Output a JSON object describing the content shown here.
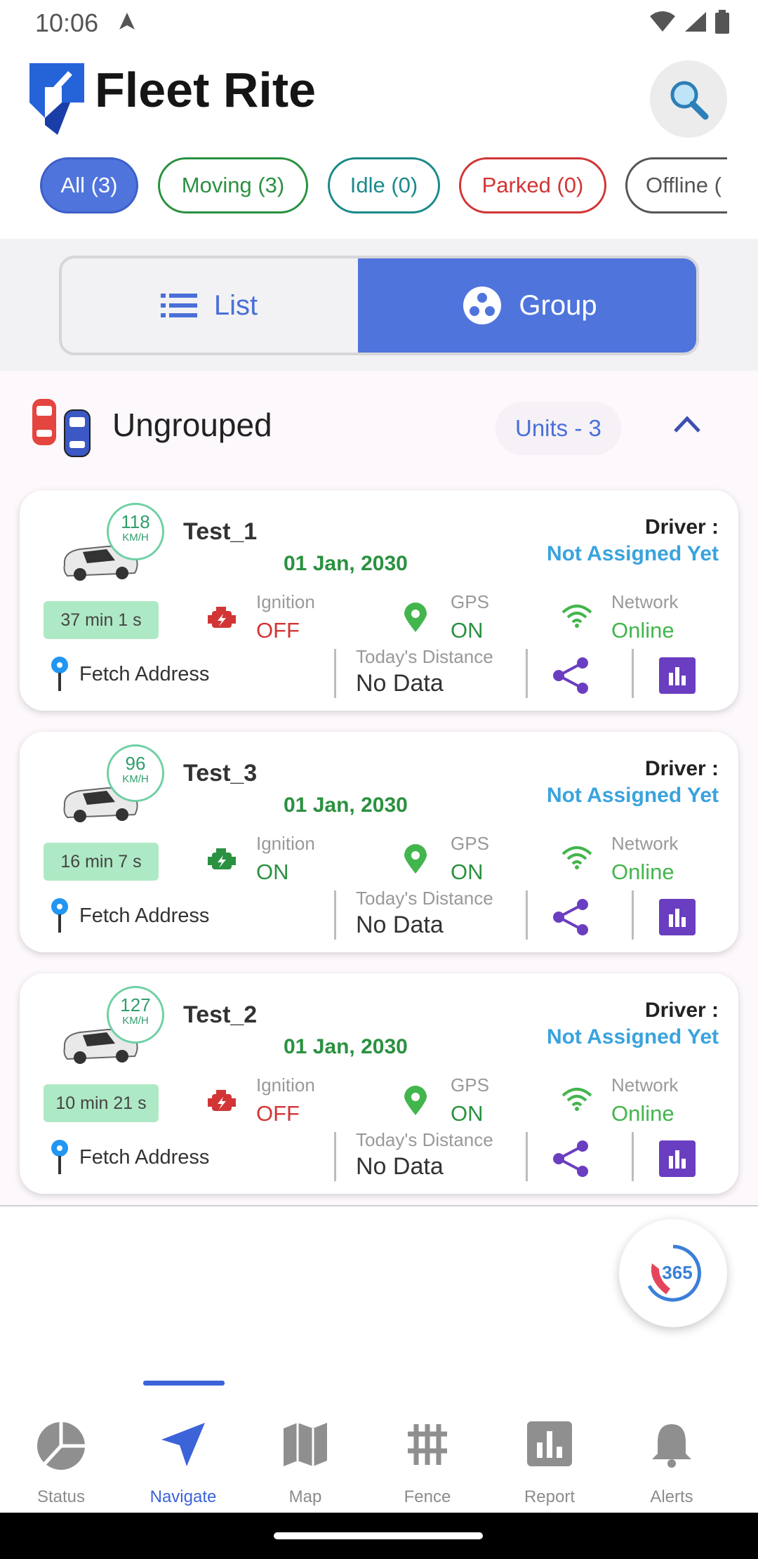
{
  "status_bar": {
    "time": "10:06"
  },
  "header": {
    "title": "Fleet Rite"
  },
  "filters": [
    {
      "label": "All (3)",
      "color": "#3d63d9",
      "active": true
    },
    {
      "label": "Moving (3)",
      "color": "#2a9140"
    },
    {
      "label": "Idle (0)",
      "color": "#1b8a8a"
    },
    {
      "label": "Parked (0)",
      "color": "#d23535"
    },
    {
      "label": "Offline (",
      "color": "#555555"
    }
  ],
  "view_toggle": {
    "list_label": "List",
    "group_label": "Group",
    "selected": "Group"
  },
  "group": {
    "name": "Ungrouped",
    "units_label": "Units - 3"
  },
  "vehicles": [
    {
      "name": "Test_1",
      "speed": "118",
      "speed_unit": "KM/H",
      "date": "01 Jan, 2030",
      "driver_label": "Driver :",
      "driver": "Not Assigned Yet",
      "duration": "37 min 1 s",
      "ignition_label": "Ignition",
      "ignition": "OFF",
      "gps_label": "GPS",
      "gps": "ON",
      "network_label": "Network",
      "network": "Online",
      "address": "Fetch Address",
      "distance_label": "Today's Distance",
      "distance": "No Data"
    },
    {
      "name": "Test_3",
      "speed": "96",
      "speed_unit": "KM/H",
      "date": "01 Jan, 2030",
      "driver_label": "Driver :",
      "driver": "Not Assigned Yet",
      "duration": "16 min 7 s",
      "ignition_label": "Ignition",
      "ignition": "ON",
      "gps_label": "GPS",
      "gps": "ON",
      "network_label": "Network",
      "network": "Online",
      "address": "Fetch Address",
      "distance_label": "Today's Distance",
      "distance": "No Data"
    },
    {
      "name": "Test_2",
      "speed": "127",
      "speed_unit": "KM/H",
      "date": "01 Jan, 2030",
      "driver_label": "Driver :",
      "driver": "Not Assigned Yet",
      "duration": "10 min 21 s",
      "ignition_label": "Ignition",
      "ignition": "OFF",
      "gps_label": "GPS",
      "gps": "ON",
      "network_label": "Network",
      "network": "Online",
      "address": "Fetch Address",
      "distance_label": "Today's Distance",
      "distance": "No Data"
    }
  ],
  "colors": {
    "accent": "#3d63d9",
    "on": "#2a9140",
    "off": "#d23535",
    "online": "#43b54d",
    "driver": "#3aa3de",
    "report": "#6a3ec0"
  },
  "fab": {
    "label": "365"
  },
  "bottom_nav": [
    {
      "label": "Status",
      "icon": "pie-chart-icon"
    },
    {
      "label": "Navigate",
      "icon": "navigate-arrow-icon",
      "active": true
    },
    {
      "label": "Map",
      "icon": "map-icon"
    },
    {
      "label": "Fence",
      "icon": "fence-grid-icon"
    },
    {
      "label": "Report",
      "icon": "bar-chart-icon"
    },
    {
      "label": "Alerts",
      "icon": "bell-icon"
    }
  ]
}
